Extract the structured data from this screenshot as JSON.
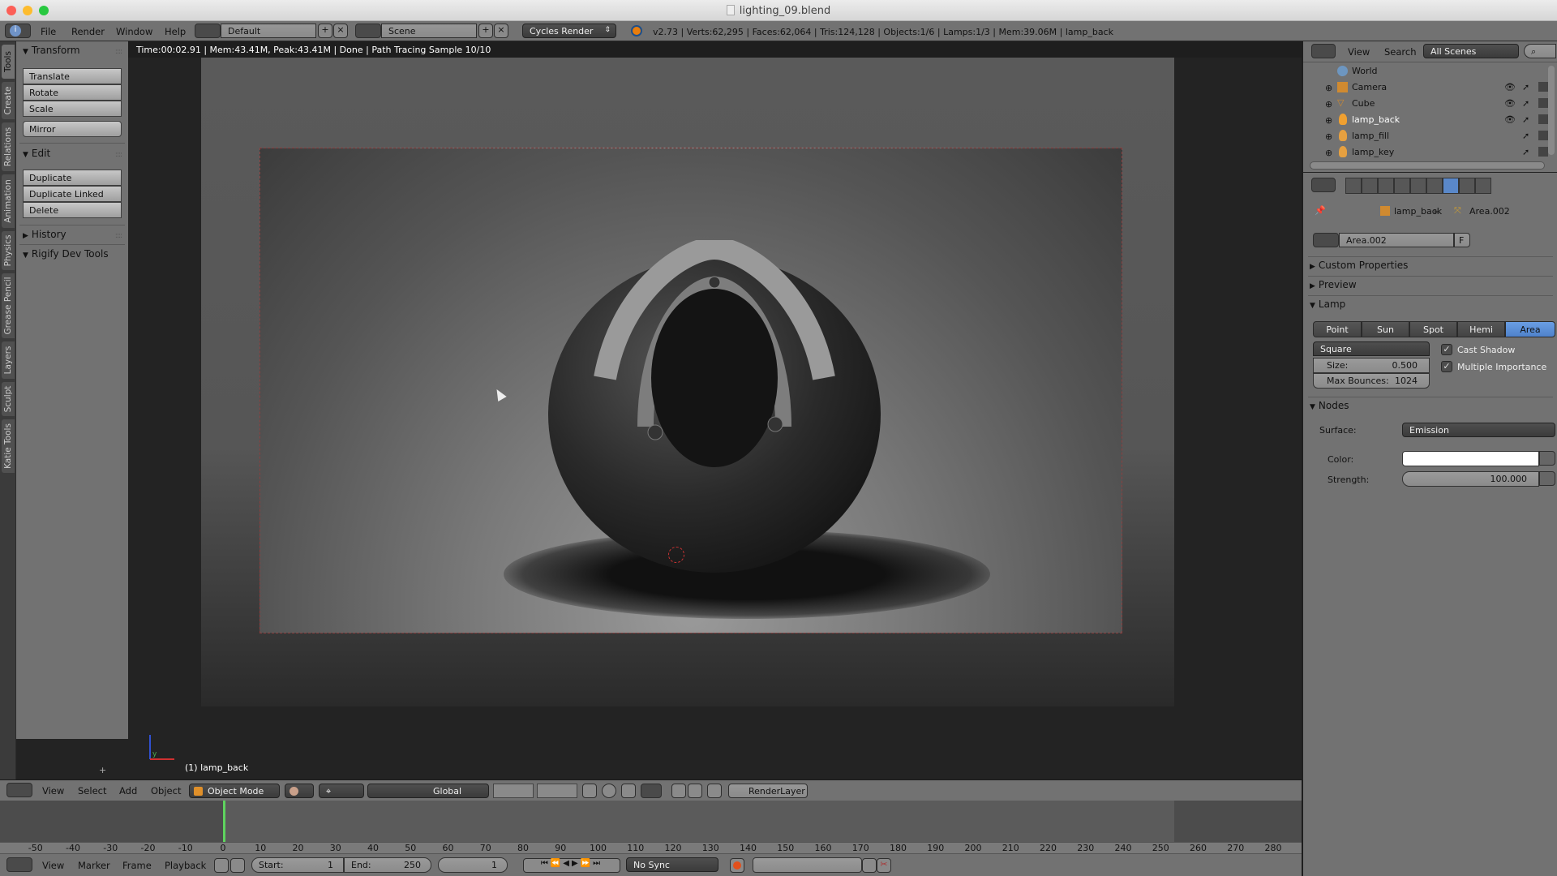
{
  "window": {
    "title": "lighting_09.blend",
    "traffic_colors": [
      "#fc5f57",
      "#fdbc2e",
      "#28c840"
    ]
  },
  "info_header": {
    "menus": [
      "File",
      "Render",
      "Window",
      "Help"
    ],
    "layout": "Default",
    "scene": "Scene",
    "engine": "Cycles Render",
    "stats": "v2.73 | Verts:62,295 | Faces:62,064 | Tris:124,128 | Objects:1/6 | Lamps:1/3 | Mem:39.06M | lamp_back"
  },
  "tool_tabs": [
    "Tools",
    "Create",
    "Relations",
    "Animation",
    "Physics",
    "Grease Pencil",
    "Layers",
    "Sculpt",
    "Katie Tools"
  ],
  "tool_shelf": {
    "transform": {
      "title": "Transform",
      "buttons": [
        "Translate",
        "Rotate",
        "Scale"
      ],
      "mirror": "Mirror"
    },
    "edit": {
      "title": "Edit",
      "buttons": [
        "Duplicate",
        "Duplicate Linked",
        "Delete"
      ]
    },
    "history": "History",
    "rigify": "Rigify Dev Tools"
  },
  "viewport": {
    "render_status": "Time:00:02.91 | Mem:43.41M, Peak:43.41M | Done | Path Tracing Sample 10/10",
    "object_label": "(1) lamp_back",
    "axis_y": "y"
  },
  "view3d_header": {
    "menus": [
      "View",
      "Select",
      "Add",
      "Object"
    ],
    "mode": "Object Mode",
    "orientation": "Global",
    "render_layer": "RenderLayer"
  },
  "timeline": {
    "ruler": [
      "-50",
      "-40",
      "-30",
      "-20",
      "-10",
      "0",
      "10",
      "20",
      "30",
      "40",
      "50",
      "60",
      "70",
      "80",
      "90",
      "100",
      "110",
      "120",
      "130",
      "140",
      "150",
      "160",
      "170",
      "180",
      "190",
      "200",
      "210",
      "220",
      "230",
      "240",
      "250",
      "260",
      "270",
      "280"
    ],
    "current_frame_marker": 0,
    "menus": [
      "View",
      "Marker",
      "Frame",
      "Playback"
    ],
    "start_label": "Start:",
    "start": "1",
    "end_label": "End:",
    "end": "250",
    "current": "1",
    "sync": "No Sync"
  },
  "outliner": {
    "menus": [
      "View",
      "Search"
    ],
    "filter": "All Scenes",
    "items": [
      {
        "name": "World",
        "icon": "world-icon"
      },
      {
        "name": "Camera",
        "icon": "camera-icon"
      },
      {
        "name": "Cube",
        "icon": "mesh-icon"
      },
      {
        "name": "lamp_back",
        "icon": "lamp-icon",
        "selected": true
      },
      {
        "name": "lamp_fill",
        "icon": "lamp-icon"
      },
      {
        "name": "lamp_key",
        "icon": "lamp-icon"
      }
    ]
  },
  "properties": {
    "breadcrumb": [
      "lamp_back",
      "Area.002"
    ],
    "datablock": "Area.002",
    "fake_user": "F",
    "sections": {
      "custom": "Custom Properties",
      "preview": "Preview",
      "lamp": "Lamp",
      "nodes": "Nodes"
    },
    "lamp_types": [
      "Point",
      "Sun",
      "Spot",
      "Hemi",
      "Area"
    ],
    "lamp_type_active": "Area",
    "shape": "Square",
    "size_label": "Size:",
    "size": "0.500",
    "bounces_label": "Max Bounces:",
    "bounces": "1024",
    "cast_shadow": "Cast Shadow",
    "multiple_importance": "Multiple Importance",
    "surface_label": "Surface:",
    "surface": "Emission",
    "color_label": "Color:",
    "color_value": "#ffffff",
    "strength_label": "Strength:",
    "strength": "100.000"
  }
}
